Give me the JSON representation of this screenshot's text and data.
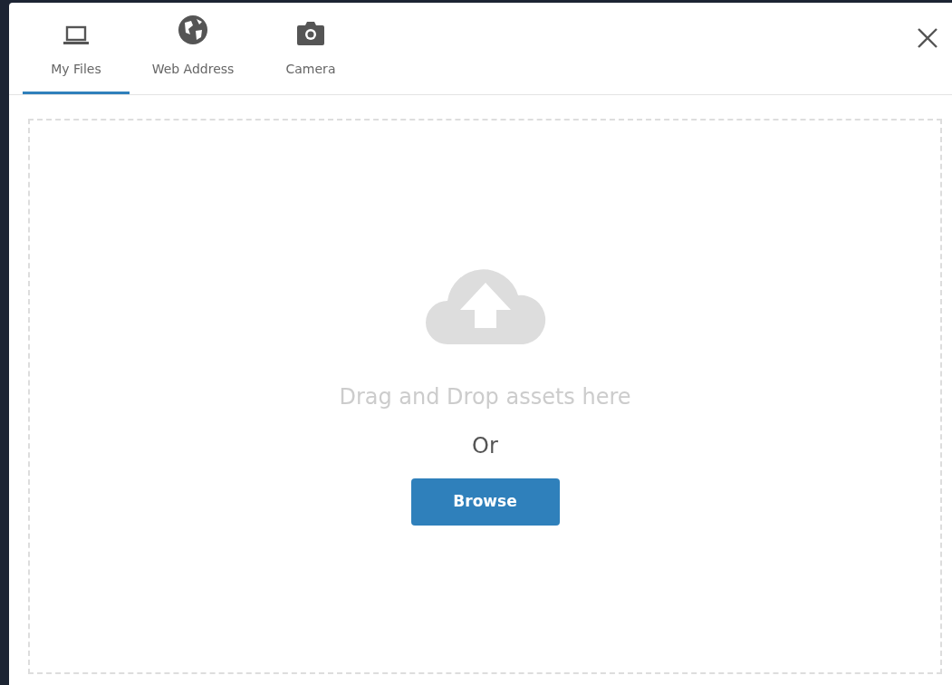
{
  "tabs": [
    {
      "label": "My Files",
      "kind": "laptop",
      "selected": true
    },
    {
      "label": "Web Address",
      "kind": "globe",
      "selected": false
    },
    {
      "label": "Camera",
      "kind": "camera",
      "selected": false
    }
  ],
  "dropzone": {
    "message": "Drag and Drop assets here",
    "separator": "Or",
    "button": "Browse"
  }
}
